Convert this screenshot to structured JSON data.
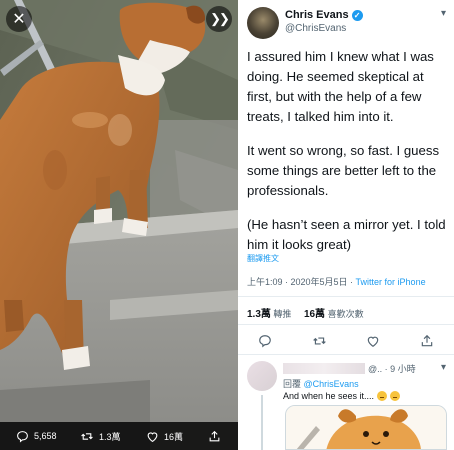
{
  "media": {
    "close_icon": "close-icon",
    "next_icon": "chevrons-right-icon",
    "actions": [
      {
        "icon": "reply-icon",
        "count": "5,658"
      },
      {
        "icon": "retweet-icon",
        "count": "1.3萬"
      },
      {
        "icon": "like-icon",
        "count": "16萬"
      },
      {
        "icon": "share-icon",
        "count": ""
      }
    ]
  },
  "tweet": {
    "name": "Chris Evans",
    "handle": "@ChrisEvans",
    "paragraphs": [
      "I assured him I knew what I was doing. He seemed skeptical at first, but with the help of a few treats, I talked him into it.",
      "It went so wrong, so fast. I guess some things are better left to the professionals.",
      "(He hasn’t seen a mirror yet. I told him it looks great)"
    ],
    "translate": "翻譯推文",
    "time": "上午1:09 · 2020年5月5日 · ",
    "source": "Twitter for iPhone",
    "retweets_count": "1.3萬",
    "retweets_label": " 轉推",
    "likes_count": "16萬",
    "likes_label": " 喜歡次數"
  },
  "reply": {
    "meta": "@.. · 9 小時",
    "replying_to": "回覆 ",
    "replying_handle": "@ChrisEvans",
    "text": "And when he sees it.... "
  },
  "colors": {
    "accent": "#1d9bf0",
    "media_bar": "#000000",
    "text": "#0f1419",
    "secondary": "#536471"
  }
}
